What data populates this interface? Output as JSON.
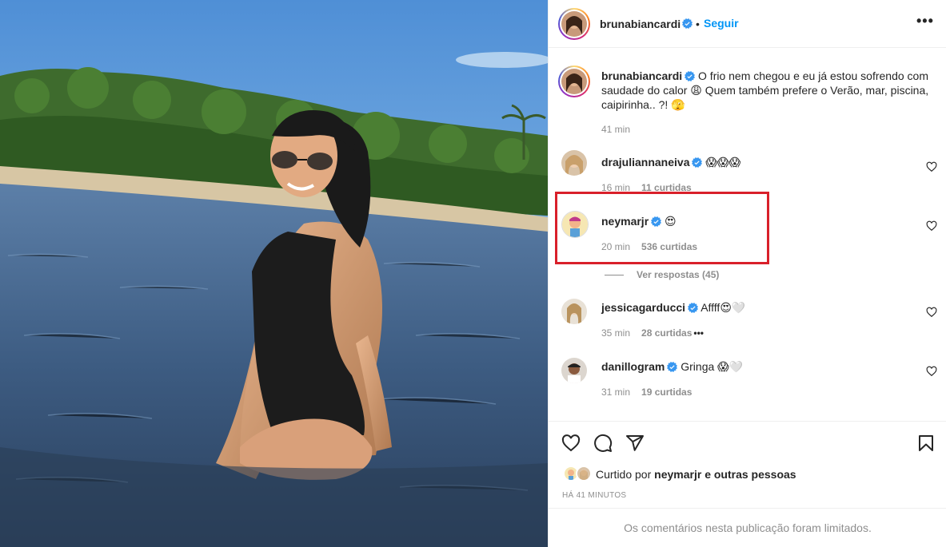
{
  "post": {
    "author": "brunabiancardi",
    "follow_label": "Seguir",
    "dot": "•",
    "more_label": "•••"
  },
  "caption": {
    "author": "brunabiancardi",
    "line1": "O frio nem chegou e eu já estou sofrendo com",
    "line2": "saudade do calor 😩 Quem também prefere o Verão, mar, piscina,",
    "line3": "caipirinha.. ?! 🫣",
    "time": "41 min"
  },
  "comments": [
    {
      "user": "drajuliannaneiva",
      "text": "😱😱😱",
      "time": "16 min",
      "likes": "11 curtidas"
    },
    {
      "user": "neymarjr",
      "text": "😍",
      "time": "20 min",
      "likes": "536 curtidas"
    },
    {
      "user": "jessicagarducci",
      "text": "Affff😍🤍",
      "time": "35 min",
      "likes": "28 curtidas",
      "more": "•••"
    },
    {
      "user": "danillogram",
      "text": "Gringa 😱🤍",
      "time": "31 min",
      "likes": "19 curtidas"
    }
  ],
  "replies_label": "Ver respostas (45)",
  "liked_by": {
    "prefix": "Curtido por ",
    "user": "neymarjr",
    "suffix": " e outras pessoas"
  },
  "post_time": "HÁ 41 MINUTOS",
  "comments_limited": "Os comentários nesta publicação foram limitados.",
  "icons": [
    "verified-badge-icon",
    "heart-icon",
    "comment-icon",
    "share-icon",
    "bookmark-icon",
    "more-icon"
  ],
  "colors": {
    "follow_blue": "#0095f6",
    "verified_blue": "#3897f0",
    "highlight_red": "#d9202a",
    "muted": "#8e8e8e"
  }
}
